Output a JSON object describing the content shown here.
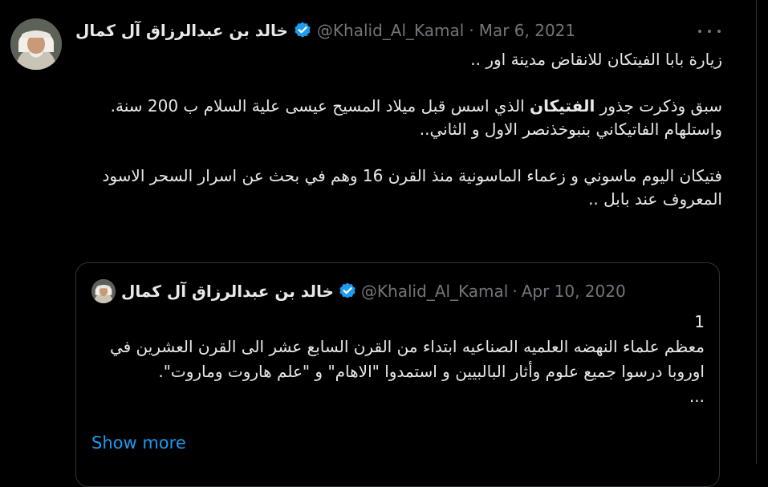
{
  "tweet": {
    "author_name": "خالد بن عبدالرزاق آل كمال",
    "handle": "@Khalid_Al_Kamal",
    "separator": "·",
    "date": "Mar 6, 2021",
    "lines": {
      "l1": "زيارة بابا الفيتكان للانقاض مدينة اور ..",
      "l2_pre": "سبق وذكرت جذور ",
      "l2_bold": "الفتيكان",
      "l2_post": " الذي اسس قبل ميلاد المسيح عيسى علية السلام ب 200 سنة.",
      "l3": "واستلهام الفاتيكاني بنبوخذنصر الاول و الثاني..",
      "l4": "فتيكان اليوم ماسوني و زعماء الماسونية منذ القرن 16 وهم في بحث عن اسرار السحر الاسود المعروف عند بابل .."
    }
  },
  "quote": {
    "author_name": "خالد بن عبدالرزاق آل كمال",
    "handle": "@Khalid_Al_Kamal",
    "separator": "·",
    "date": "Apr 10, 2020",
    "l1": "1",
    "l2": "معظم علماء النهضه العلميه الصناعيه ابتداء من القرن السابع عشر الى القرن العشرين في اوروبا درسوا جميع علوم وأثار البالبيين و استمدوا \"الاهام\" و \"علم هاروت وماروت\".",
    "l3": "...",
    "show_more": "Show more"
  },
  "icons": {
    "verified": "verified-badge-icon",
    "more": "more-options-icon"
  },
  "colors": {
    "background": "#000000",
    "text": "#e7e9ea",
    "muted": "#71767b",
    "accent": "#1d9bf0",
    "border": "#2f3336"
  }
}
